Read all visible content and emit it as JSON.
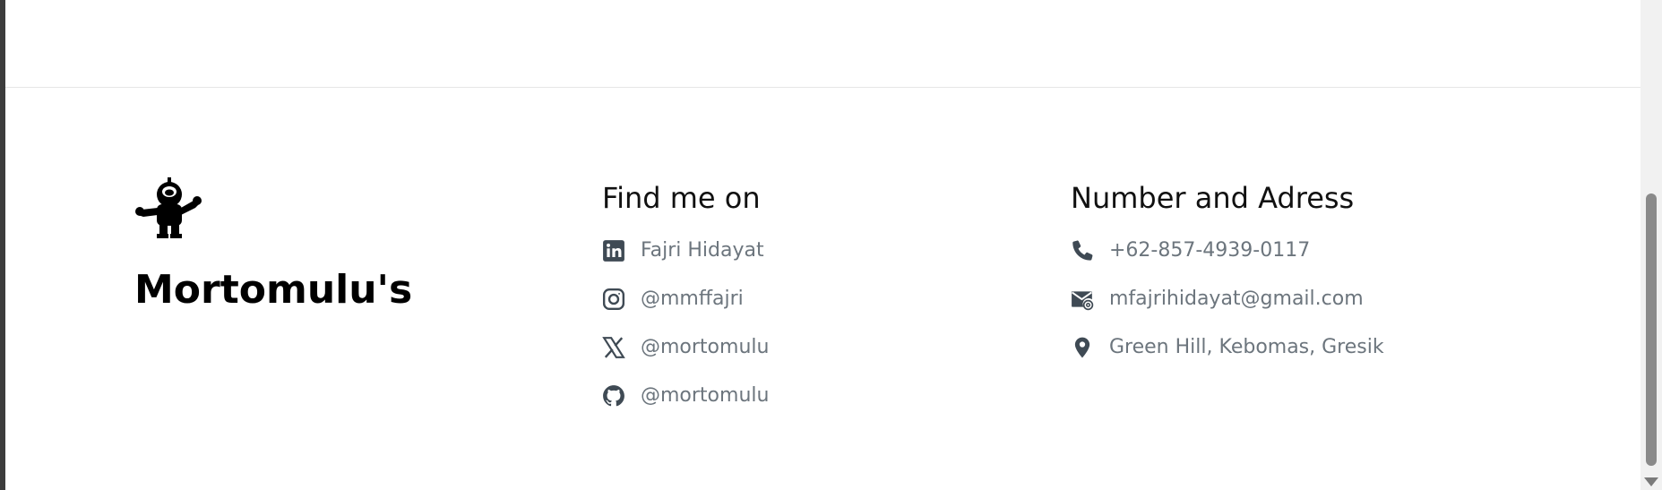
{
  "brand": {
    "name": "Mortomulu's",
    "logo_icon": "astronaut-icon"
  },
  "social": {
    "heading": "Find me on",
    "items": [
      {
        "icon": "linkedin-icon",
        "label": "Fajri Hidayat"
      },
      {
        "icon": "instagram-icon",
        "label": "@mmffajri"
      },
      {
        "icon": "x-twitter-icon",
        "label": "@mortomulu"
      },
      {
        "icon": "github-icon",
        "label": "@mortomulu"
      }
    ]
  },
  "contact": {
    "heading": "Number and Adress",
    "items": [
      {
        "icon": "phone-icon",
        "label": "+62-857-4939-0117"
      },
      {
        "icon": "email-icon",
        "label": "mfajrihidayat@gmail.com"
      },
      {
        "icon": "location-pin-icon",
        "label": "Green Hill, Kebomas, Gresik"
      }
    ]
  },
  "colors": {
    "heading": "#111111",
    "muted_text": "#6c757d",
    "icon": "#3f4a54",
    "brand": "#000000"
  }
}
